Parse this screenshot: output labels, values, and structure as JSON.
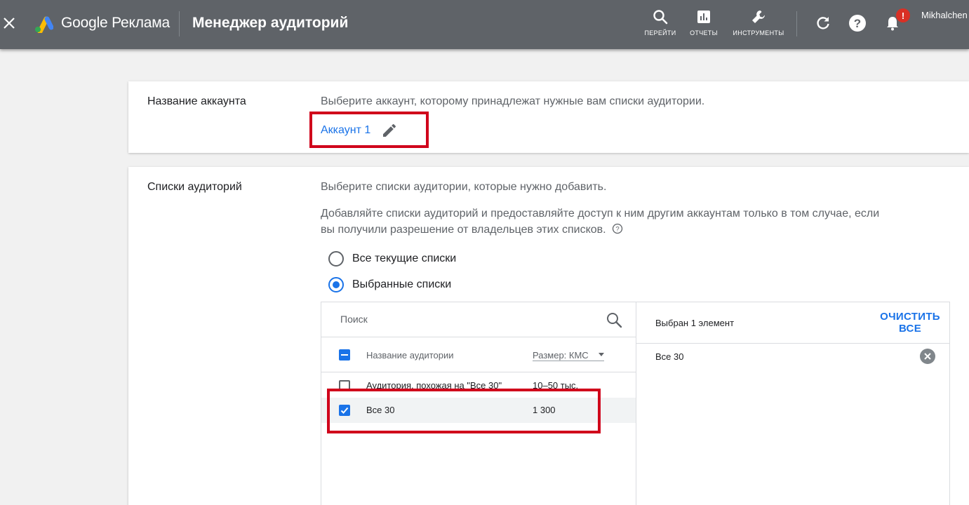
{
  "header": {
    "brand": "Google Реклама",
    "title": "Менеджер аудиторий",
    "tools": [
      {
        "label": "ПЕРЕЙТИ",
        "icon": "search-icon"
      },
      {
        "label": "ОТЧЕТЫ",
        "icon": "reports-icon"
      },
      {
        "label": "ИНСТРУМЕНТЫ",
        "icon": "wrench-icon"
      }
    ],
    "notification_badge": "!",
    "user": "Mikhalchen"
  },
  "account_section": {
    "label": "Название аккаунта",
    "hint": "Выберите аккаунт, которому принадлежат нужные вам списки аудитории.",
    "account_name": "Аккаунт 1"
  },
  "lists_section": {
    "label": "Списки аудиторий",
    "hint1": "Выберите списки аудитории, которые нужно добавить.",
    "hint2_line1": "Добавляйте списки аудиторий и предоставляйте доступ к ним другим аккаунтам только в том случае, если",
    "hint2_line2": "вы получили разрешение от владельцев этих списков.",
    "radio_all": "Все текущие списки",
    "radio_selected": "Выбранные списки",
    "search_placeholder": "Поиск",
    "col_name": "Название аудитории",
    "col_size": "Размер: КМС",
    "rows": [
      {
        "name": "Аудитория, похожая на \"Все 30\"",
        "size": "10–50 тыс.",
        "checked": false
      },
      {
        "name": "Все 30",
        "size": "1 300",
        "checked": true
      }
    ],
    "selected_count": "Выбран 1 элемент",
    "clear_all_line1": "ОЧИСТИТЬ",
    "clear_all_line2": "ВСЕ",
    "selected_items": [
      "Все 30"
    ]
  },
  "colors": {
    "topbar": "#5f6368",
    "accent": "#1a73e8",
    "highlight": "#d0021b"
  }
}
